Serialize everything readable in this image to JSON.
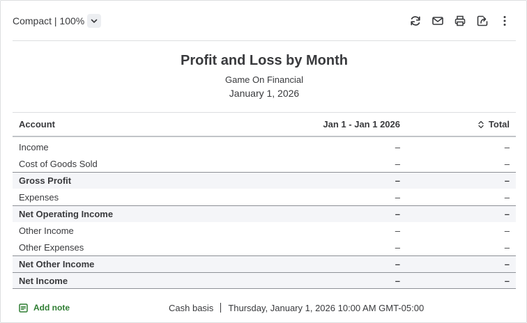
{
  "toolbar": {
    "view_label": "Compact | 100%",
    "icons": [
      "refresh-icon",
      "email-icon",
      "print-icon",
      "export-icon",
      "more-icon"
    ]
  },
  "report": {
    "title": "Profit and Loss by Month",
    "company": "Game On Financial",
    "date": "January 1, 2026"
  },
  "table": {
    "headers": {
      "account": "Account",
      "period": "Jan 1 - Jan 1 2026",
      "total": "Total"
    },
    "rows": [
      {
        "account": "Income",
        "period": "–",
        "total": "–",
        "type": "normal"
      },
      {
        "account": "Cost of Goods Sold",
        "period": "–",
        "total": "–",
        "type": "normal"
      },
      {
        "account": "Gross Profit",
        "period": "–",
        "total": "–",
        "type": "total"
      },
      {
        "account": "Expenses",
        "period": "–",
        "total": "–",
        "type": "normal"
      },
      {
        "account": "Net Operating Income",
        "period": "–",
        "total": "–",
        "type": "total"
      },
      {
        "account": "Other Income",
        "period": "–",
        "total": "–",
        "type": "normal"
      },
      {
        "account": "Other Expenses",
        "period": "–",
        "total": "–",
        "type": "normal"
      },
      {
        "account": "Net Other Income",
        "period": "–",
        "total": "–",
        "type": "total"
      },
      {
        "account": "Net Income",
        "period": "–",
        "total": "–",
        "type": "total"
      }
    ]
  },
  "footer": {
    "add_note": "Add note",
    "basis": "Cash basis",
    "timestamp": "Thursday, January 1, 2026 10:00 AM GMT-05:00"
  },
  "colors": {
    "accent_green": "#2e7d32",
    "text": "#393a3d",
    "total_row_bg": "#f4f5f8"
  }
}
